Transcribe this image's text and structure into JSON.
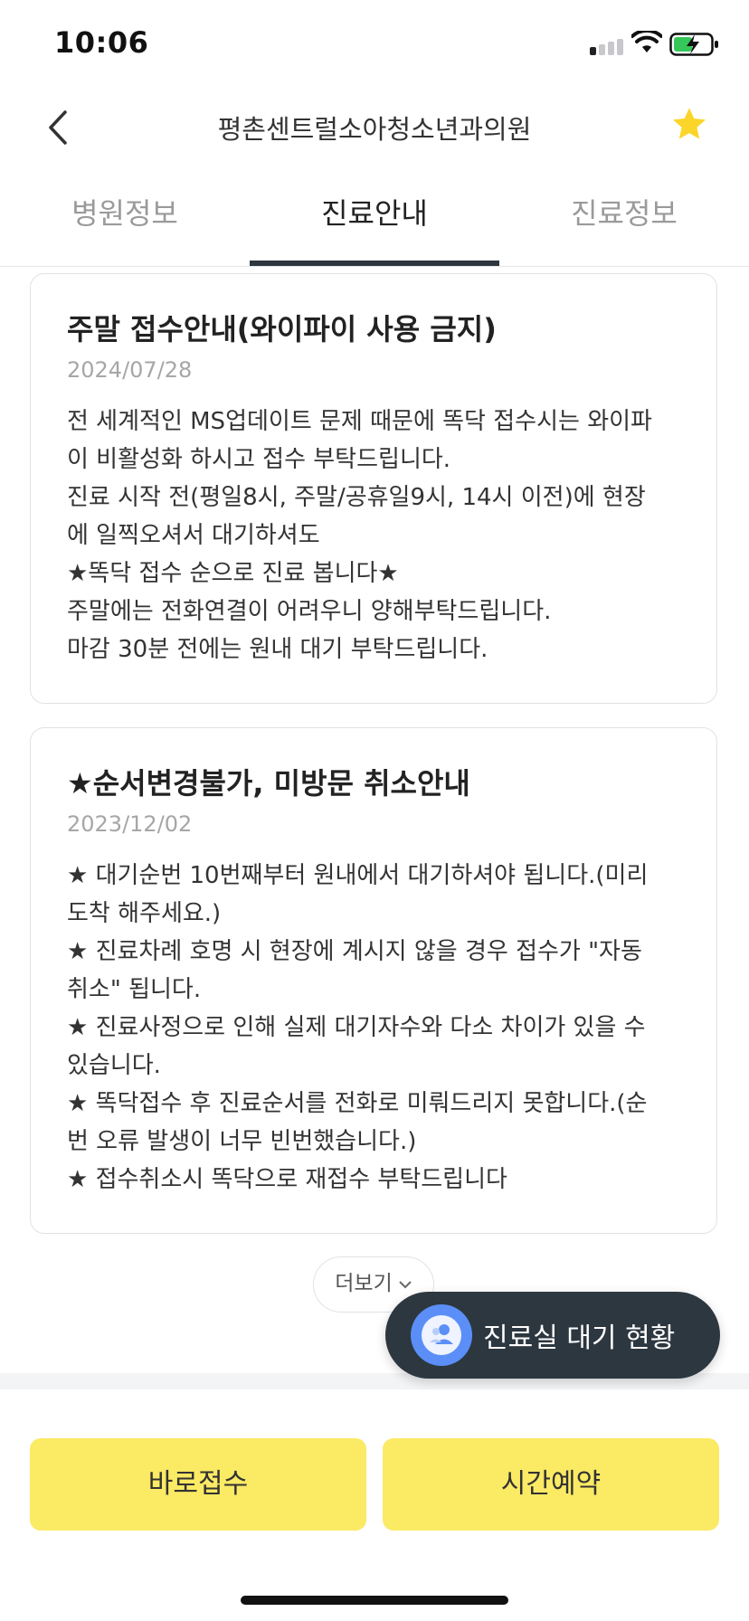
{
  "status_bar": {
    "time": "10:06"
  },
  "header": {
    "title": "평촌센트럴소아청소년과의원"
  },
  "tabs": [
    {
      "label": "병원정보",
      "selected": false
    },
    {
      "label": "진료안내",
      "selected": true
    },
    {
      "label": "진료정보",
      "selected": false
    }
  ],
  "notices": [
    {
      "title": "주말 접수안내(와이파이 사용 금지)",
      "date": "2024/07/28",
      "lines": [
        "전 세계적인 MS업데이트 문제 때문에 똑닥 접수시는 와이파",
        "이 비활성화 하시고 접수 부탁드립니다.",
        "진료 시작 전(평일8시, 주말/공휴일9시, 14시 이전)에 현장",
        "에 일찍오셔서 대기하셔도",
        "★똑닥 접수 순으로 진료 봅니다★",
        "주말에는 전화연결이 어려우니 양해부탁드립니다.",
        "마감 30분 전에는 원내 대기 부탁드립니다."
      ]
    },
    {
      "title": "★순서변경불가, 미방문 취소안내",
      "date": "2023/12/02",
      "lines": [
        "★ 대기순번 10번째부터 원내에서 대기하셔야 됩니다.(미리",
        "도착 해주세요.)",
        "★ 진료차례 호명 시 현장에 계시지 않을 경우 접수가 \"자동",
        "취소\" 됩니다.",
        "★ 진료사정으로 인해 실제 대기자수와 다소 차이가 있을 수",
        "있습니다.",
        "★ 똑닥접수 후 진료순서를 전화로 미뤄드리지 못합니다.(순",
        "번 오류 발생이 너무 빈번했습니다.)",
        "★ 접수취소시 똑닥으로 재접수 부탁드립니다"
      ]
    }
  ],
  "more_button": {
    "label": "더보기"
  },
  "waiting_button": {
    "label": "진료실 대기 현황"
  },
  "actions": {
    "quick_reception": "바로접수",
    "time_reservation": "시간예약"
  },
  "colors": {
    "accent_yellow": "#fbea64",
    "dark": "#2d3740",
    "star": "#fcd52b"
  }
}
